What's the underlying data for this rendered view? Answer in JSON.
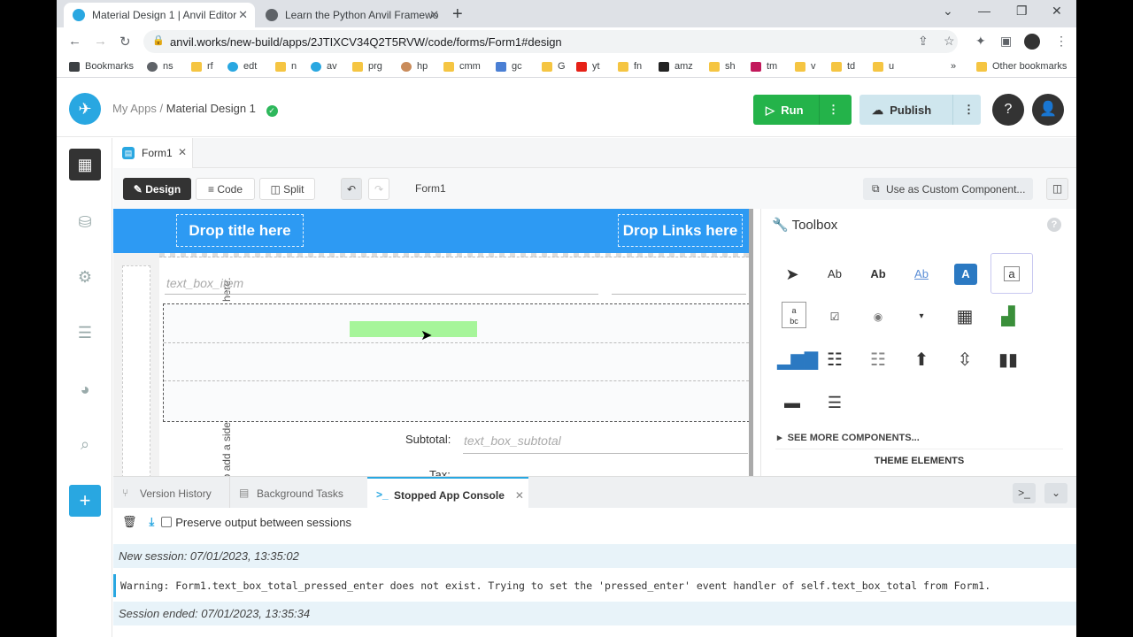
{
  "browser": {
    "tabs": [
      {
        "title": "Material Design 1 | Anvil Editor",
        "close": "✕"
      },
      {
        "title": "Learn the Python Anvil Framewo",
        "close": "✕"
      }
    ],
    "new_tab": "+",
    "url": "anvil.works/new-build/apps/2JTIXCV34Q2T5RVW/code/forms/Form1#design",
    "bookmarks": [
      "Bookmarks",
      "ns",
      "rf",
      "edt",
      "n",
      "av",
      "prg",
      "hp",
      "cmm",
      "gc",
      "G",
      "yt",
      "fn",
      "amz",
      "sh",
      "tm",
      "v",
      "td",
      "u"
    ],
    "other_bookmarks": "Other bookmarks",
    "more": "»"
  },
  "header": {
    "my_apps": "My Apps",
    "separator": "/",
    "app_name": "Material Design 1",
    "run_label": "Run",
    "publish_label": "Publish"
  },
  "form_tab": {
    "name": "Form1"
  },
  "toolbar": {
    "design": "Design",
    "code": "Code",
    "split": "Split",
    "form_name": "Form1",
    "custom_component": "Use as Custom Component..."
  },
  "canvas": {
    "drop_title": "Drop title here",
    "drop_links": "Drop Links here",
    "sidebar_hint": "To add a sidebar, drop a ColumnPanel here.",
    "text_box_item": "text_box_item",
    "subtotal_label": "Subtotal:",
    "text_box_subtotal": "text_box_subtotal",
    "tax_label": "Tax:"
  },
  "toolbox": {
    "title": "Toolbox",
    "help": "?",
    "items": {
      "label": "Ab",
      "bold_label": "Ab",
      "link": "Ab",
      "button": "A",
      "textbox": "a"
    },
    "see_more": "SEE MORE COMPONENTS...",
    "theme_elements": "THEME ELEMENTS"
  },
  "bottom": {
    "tabs": [
      "Version History",
      "Background Tasks",
      "Stopped App Console"
    ],
    "preserve_label": "Preserve output between sessions",
    "session_new": "New session: 07/01/2023, 13:35:02",
    "warning": "Warning: Form1.text_box_total_pressed_enter does not exist. Trying to set the 'pressed_enter' event handler of self.text_box_total from Form1.",
    "session_end": "Session ended: 07/01/2023, 13:35:34"
  },
  "colors": {
    "accent": "#29a7e1",
    "run_green": "#24b34a",
    "app_bar_blue": "#2d9af3",
    "drop_green": "#a6f59a"
  }
}
